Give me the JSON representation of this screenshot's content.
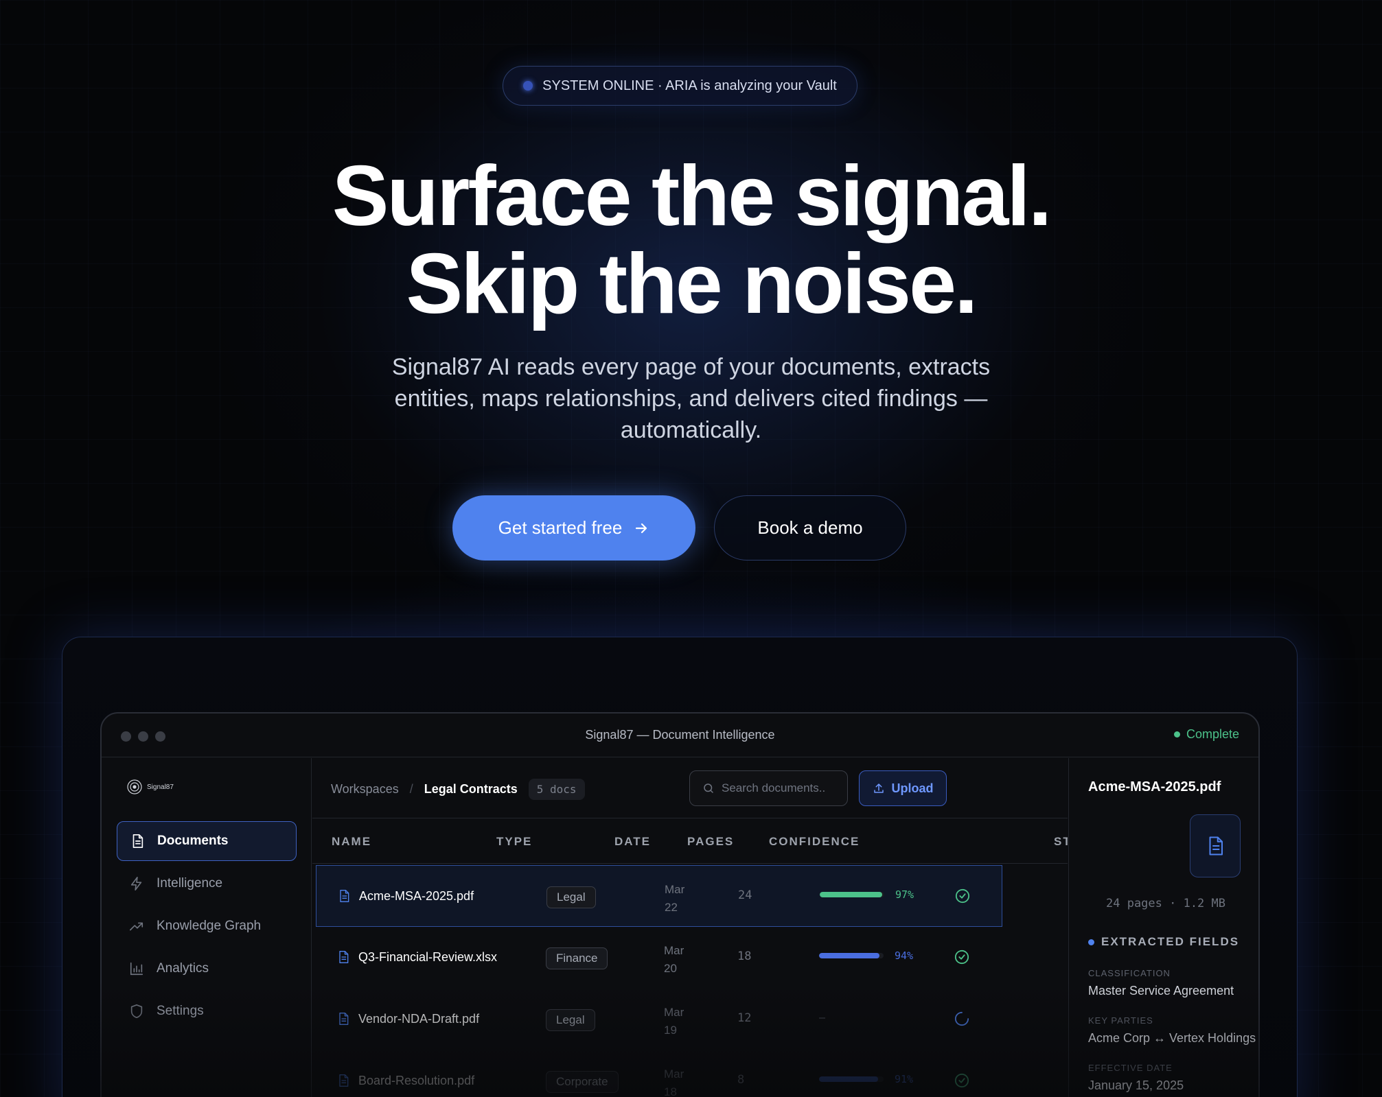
{
  "status_pill": {
    "text": "SYSTEM ONLINE · ARIA is analyzing your Vault"
  },
  "hero": {
    "headline_line1": "Surface the signal.",
    "headline_line2": "Skip the noise.",
    "subhead": "Signal87 AI reads every page of your documents, extracts entities, maps relationships, and delivers cited findings — automatically.",
    "primary_cta": "Get started free",
    "secondary_cta": "Book a demo"
  },
  "app": {
    "window_title": "Signal87 — Document Intelligence",
    "status": "Complete",
    "brand": "Signal87",
    "sidebar": {
      "items": [
        {
          "label": "Documents",
          "icon": "document-icon",
          "active": true
        },
        {
          "label": "Intelligence",
          "icon": "lightning-icon",
          "active": false
        },
        {
          "label": "Knowledge Graph",
          "icon": "trend-icon",
          "active": false
        },
        {
          "label": "Analytics",
          "icon": "bar-chart-icon",
          "active": false
        },
        {
          "label": "Settings",
          "icon": "shield-icon",
          "active": false
        }
      ]
    },
    "toolbar": {
      "breadcrumb_root": "Workspaces",
      "breadcrumb_sep": "/",
      "breadcrumb_current": "Legal Contracts",
      "doc_count": "5 docs",
      "search_placeholder": "Search documents...",
      "upload_label": "Upload"
    },
    "table": {
      "columns": [
        "NAME",
        "TYPE",
        "DATE",
        "PAGES",
        "CONFIDENCE",
        "ST"
      ],
      "rows": [
        {
          "name": "Acme-MSA-2025.pdf",
          "type": "Legal",
          "date_month": "Mar",
          "date_day": "22",
          "pages": "24",
          "confidence": 0.97,
          "confidence_text": "97%",
          "bar_color": "#4cc28a",
          "conf_color": "#4cc28a",
          "status": "complete",
          "selected": true
        },
        {
          "name": "Q3-Financial-Review.xlsx",
          "type": "Finance",
          "date_month": "Mar",
          "date_day": "20",
          "pages": "18",
          "confidence": 0.94,
          "confidence_text": "94%",
          "bar_color": "#4a6ee0",
          "conf_color": "#4a6ee0",
          "status": "complete",
          "selected": false
        },
        {
          "name": "Vendor-NDA-Draft.pdf",
          "type": "Legal",
          "date_month": "Mar",
          "date_day": "19",
          "pages": "12",
          "confidence": null,
          "confidence_text": "—",
          "bar_color": "",
          "conf_color": "#4a4e58",
          "status": "processing",
          "selected": false
        },
        {
          "name": "Board-Resolution.pdf",
          "type": "Corporate",
          "date_month": "Mar",
          "date_day": "18",
          "pages": "8",
          "confidence": 0.91,
          "confidence_text": "91%",
          "bar_color": "#2d4a94",
          "conf_color": "#3a5cb0",
          "status": "complete",
          "selected": false
        }
      ]
    },
    "detail": {
      "file_name": "Acme-MSA-2025.pdf",
      "meta": "24 pages · 1.2 MB",
      "fields_heading": "EXTRACTED FIELDS",
      "fields": [
        {
          "label": "CLASSIFICATION",
          "value": "Master Service Agreement"
        },
        {
          "label": "KEY PARTIES",
          "value": "Acme Corp ↔ Vertex Holdings"
        },
        {
          "label": "EFFECTIVE DATE",
          "value": "January 15, 2025"
        }
      ]
    }
  },
  "colors": {
    "accent": "#4f82ee",
    "success": "#4cc28a",
    "background": "#050608"
  }
}
